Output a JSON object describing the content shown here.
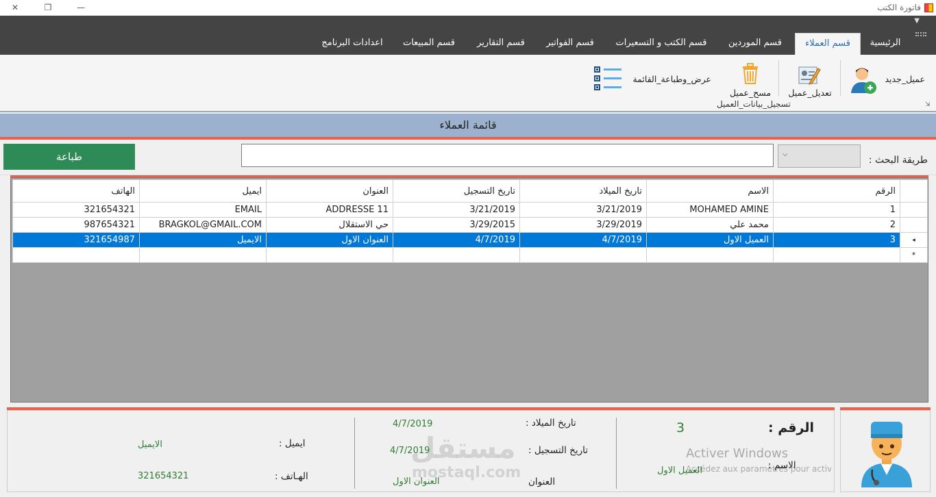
{
  "window": {
    "title": "فاتورة الكتب",
    "minimize": "—",
    "maximize": "❐",
    "close": "✕"
  },
  "tabs": [
    {
      "label": "الرئيسية"
    },
    {
      "label": "قسم العملاء"
    },
    {
      "label": "قسم الموردين"
    },
    {
      "label": "قسم الكتب و التسعيرات"
    },
    {
      "label": "قسم الفواتير"
    },
    {
      "label": "قسم التقارير"
    },
    {
      "label": "قسم المبيعات"
    },
    {
      "label": "اعدادات البرنامج"
    }
  ],
  "ribbon": {
    "new_client": "عميل_جديد",
    "edit_client": "تعديل_عميل",
    "delete_client": "مسح_عميل",
    "show_print_list": "عرض_وطباعة_القائمة",
    "group_label": "تسجيل_بيانات_العميل"
  },
  "list_title": "قائمة العملاء",
  "search": {
    "label": "طريقة البحث :",
    "value": "",
    "print_button": "طباعة"
  },
  "grid": {
    "columns": [
      "الرقم",
      "الاسم",
      "تاريخ الميلاد",
      "تاريخ التسجيل",
      "العنوان",
      "ايميل",
      "الهاتف"
    ],
    "rows": [
      {
        "id": "1",
        "name": "MOHAMED AMINE",
        "birth": "3/21/2019",
        "reg": "3/21/2019",
        "address": "ADDRESSE 11",
        "email": "EMAIL",
        "phone": "321654321"
      },
      {
        "id": "2",
        "name": "محمد علي",
        "birth": "3/29/2019",
        "reg": "3/29/2015",
        "address": "حي الاستقلال",
        "email": "BRAGKOL@GMAIL.COM",
        "phone": "987654321"
      },
      {
        "id": "3",
        "name": "العميل الاول",
        "birth": "4/7/2019",
        "reg": "4/7/2019",
        "address": "العنوان الاول",
        "email": "الايميل",
        "phone": "321654987"
      }
    ],
    "new_row_marker": "*",
    "current_row_marker": "◂"
  },
  "details": {
    "id_label": "الرقم :",
    "id_value": "3",
    "name_label": "الاسم :",
    "name_value": "العميل الاول",
    "birth_label": "تاريخ الميلاد :",
    "birth_value": "4/7/2019",
    "reg_label": "تاريخ التسجيل :",
    "reg_value": "4/7/2019",
    "address_label": "العنوان",
    "address_value": "العنوان الاول",
    "email_label": "ايميل :",
    "email_value": "الايميل",
    "phone_label": "الهـاتف :",
    "phone_value": "321654321"
  },
  "overlay": {
    "activate_title": "Activer Windows",
    "activate_sub": "Accédez aux paramètres pour activer Windows.",
    "brand_ar": "مستقل",
    "brand_en": "mostaql.com"
  }
}
